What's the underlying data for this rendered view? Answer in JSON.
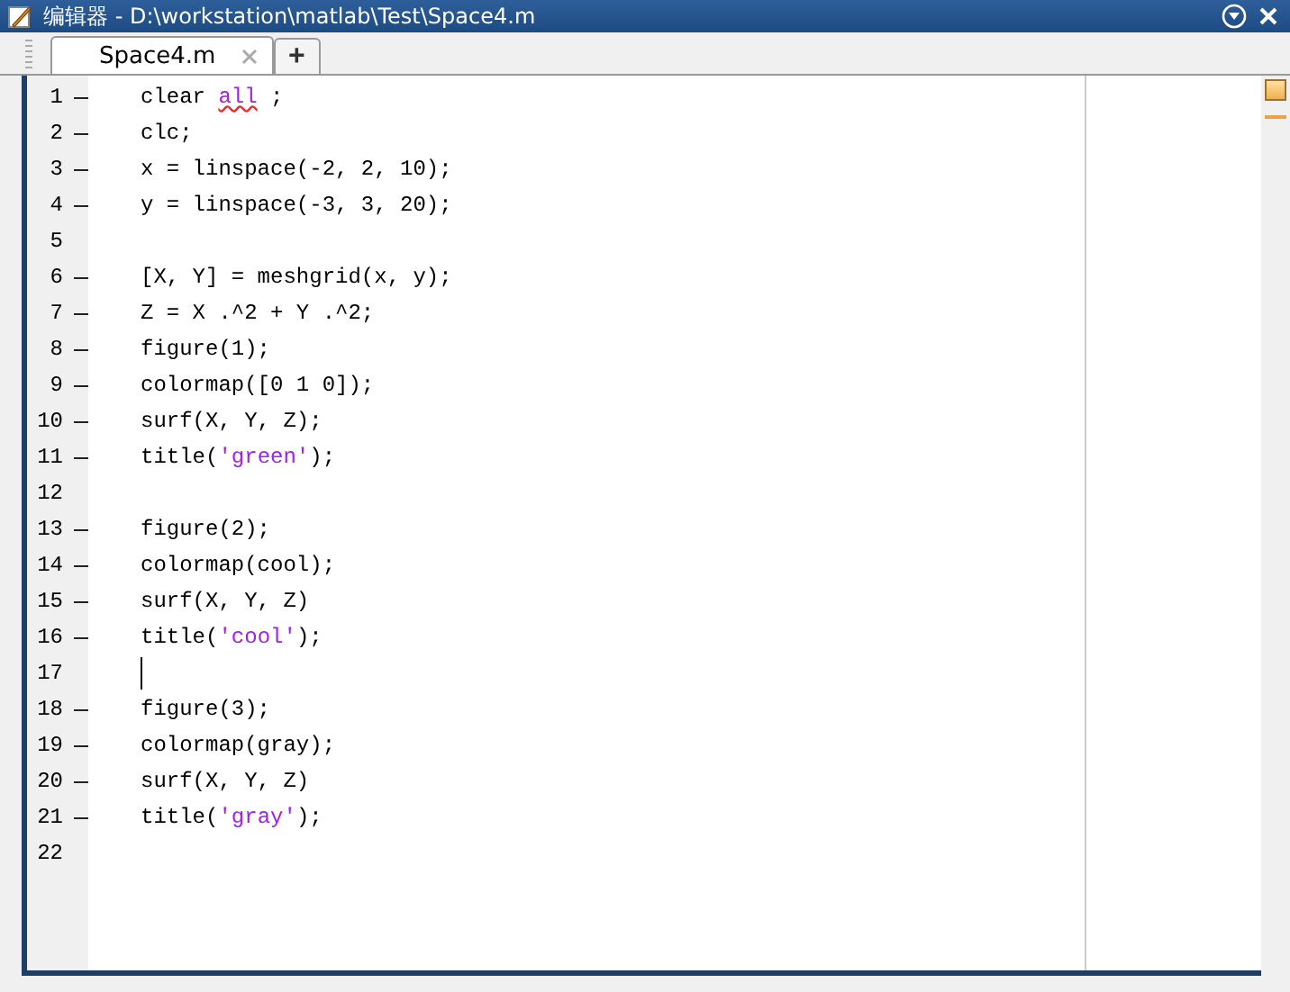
{
  "window": {
    "title": "编辑器 - D:\\workstation\\matlab\\Test\\Space4.m"
  },
  "tabs": [
    {
      "label": "Space4.m",
      "selected": true
    }
  ],
  "new_tab": "+",
  "editor": {
    "lines": [
      {
        "number": "1",
        "executable": true,
        "cursor": false,
        "code": [
          {
            "text": "clear ",
            "kind": "plain"
          },
          {
            "text": "all",
            "kind": "warning"
          },
          {
            "text": " ;",
            "kind": "plain"
          }
        ]
      },
      {
        "number": "2",
        "executable": true,
        "cursor": false,
        "code": [
          {
            "text": "clc;",
            "kind": "plain"
          }
        ]
      },
      {
        "number": "3",
        "executable": true,
        "cursor": false,
        "code": [
          {
            "text": "x = linspace(-2, 2, 10);",
            "kind": "plain"
          }
        ]
      },
      {
        "number": "4",
        "executable": true,
        "cursor": false,
        "code": [
          {
            "text": "y = linspace(-3, 3, 20);",
            "kind": "plain"
          }
        ]
      },
      {
        "number": "5",
        "executable": false,
        "cursor": false
      },
      {
        "number": "6",
        "executable": true,
        "cursor": false,
        "code": [
          {
            "text": "[X, Y] = meshgrid(x, y);",
            "kind": "plain"
          }
        ]
      },
      {
        "number": "7",
        "executable": true,
        "cursor": false,
        "code": [
          {
            "text": "Z = X .^2 + Y .^2;",
            "kind": "plain"
          }
        ]
      },
      {
        "number": "8",
        "executable": true,
        "cursor": false,
        "code": [
          {
            "text": "figure(1);",
            "kind": "plain"
          }
        ]
      },
      {
        "number": "9",
        "executable": true,
        "cursor": false,
        "code": [
          {
            "text": "colormap([0 1 0]);",
            "kind": "plain"
          }
        ]
      },
      {
        "number": "10",
        "executable": true,
        "cursor": false,
        "code": [
          {
            "text": "surf(X, Y, Z);",
            "kind": "plain"
          }
        ]
      },
      {
        "number": "11",
        "executable": true,
        "cursor": false,
        "code": [
          {
            "text": "title(",
            "kind": "plain"
          },
          {
            "text": "'green'",
            "kind": "string"
          },
          {
            "text": ");",
            "kind": "plain"
          }
        ]
      },
      {
        "number": "12",
        "executable": false,
        "cursor": false
      },
      {
        "number": "13",
        "executable": true,
        "cursor": false,
        "code": [
          {
            "text": "figure(2);",
            "kind": "plain"
          }
        ]
      },
      {
        "number": "14",
        "executable": true,
        "cursor": false,
        "code": [
          {
            "text": "colormap(cool);",
            "kind": "plain"
          }
        ]
      },
      {
        "number": "15",
        "executable": true,
        "cursor": false,
        "code": [
          {
            "text": "surf(X, Y, Z)",
            "kind": "plain"
          }
        ]
      },
      {
        "number": "16",
        "executable": true,
        "cursor": false,
        "code": [
          {
            "text": "title(",
            "kind": "plain"
          },
          {
            "text": "'cool'",
            "kind": "string"
          },
          {
            "text": ");",
            "kind": "plain"
          }
        ]
      },
      {
        "number": "17",
        "executable": false,
        "cursor": true
      },
      {
        "number": "18",
        "executable": true,
        "cursor": false,
        "code": [
          {
            "text": "figure(3);",
            "kind": "plain"
          }
        ]
      },
      {
        "number": "19",
        "executable": true,
        "cursor": false,
        "code": [
          {
            "text": "colormap(gray);",
            "kind": "plain"
          }
        ]
      },
      {
        "number": "20",
        "executable": true,
        "cursor": false,
        "code": [
          {
            "text": "surf(X, Y, Z)",
            "kind": "plain"
          }
        ]
      },
      {
        "number": "21",
        "executable": true,
        "cursor": false,
        "code": [
          {
            "text": "title(",
            "kind": "plain"
          },
          {
            "text": "'gray'",
            "kind": "string"
          },
          {
            "text": ");",
            "kind": "plain"
          }
        ]
      },
      {
        "number": "22",
        "executable": false,
        "cursor": false
      }
    ]
  }
}
